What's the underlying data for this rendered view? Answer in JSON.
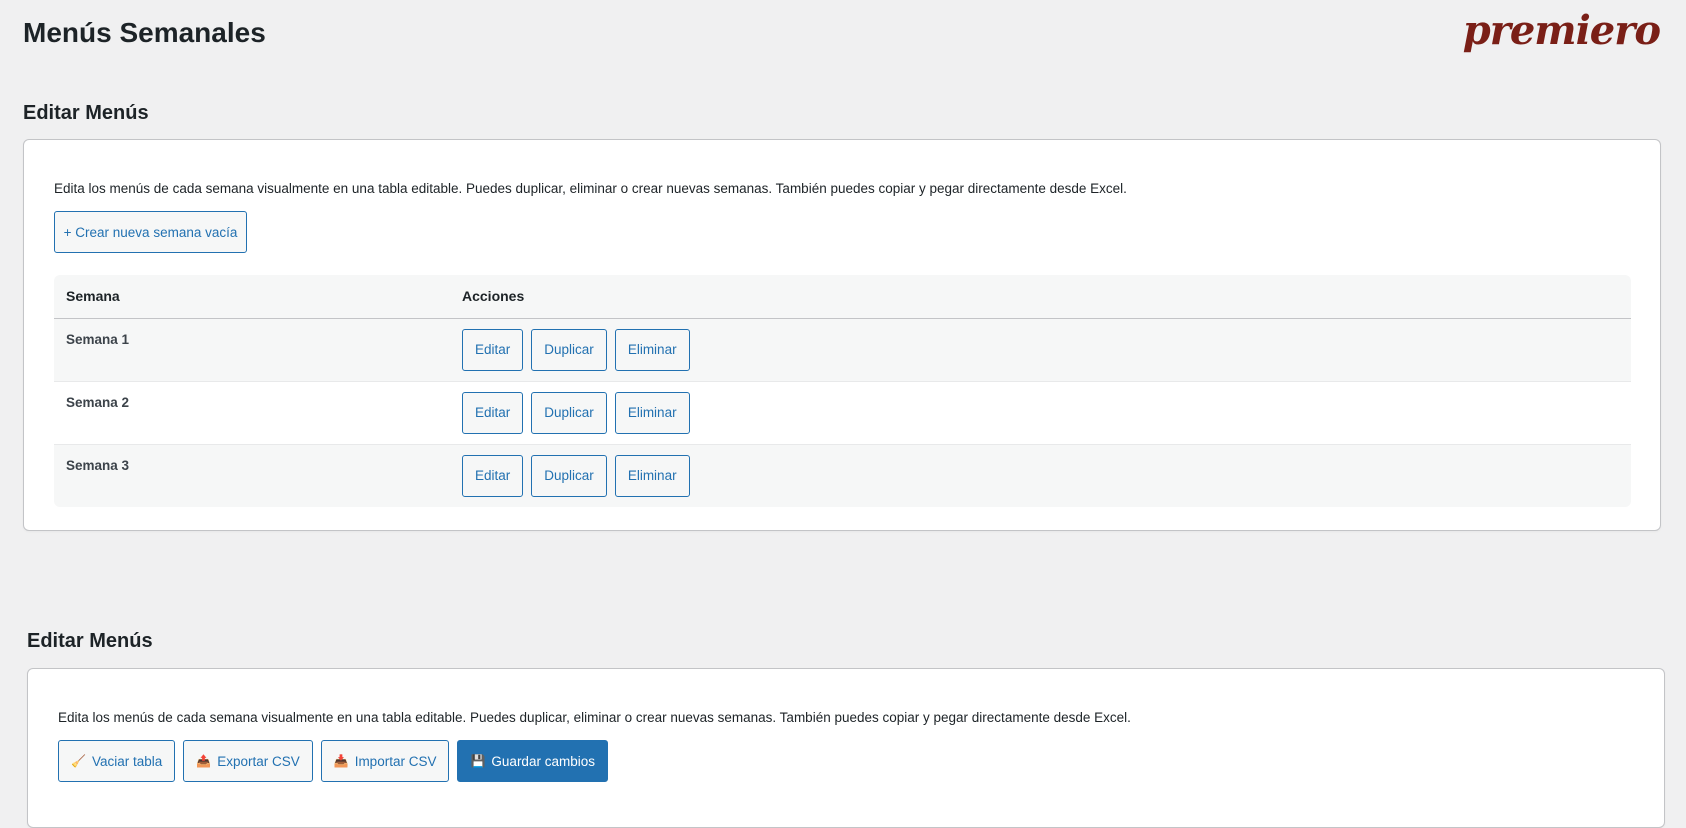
{
  "header": {
    "title": "Menús Semanales",
    "logo_text": "premiero"
  },
  "section1": {
    "title": "Editar Menús",
    "description": "Edita los menús de cada semana visualmente en una tabla editable. Puedes duplicar, eliminar o crear nuevas semanas. También puedes copiar y pegar directamente desde Excel.",
    "create_button": "+ Crear nueva semana vacía",
    "table": {
      "headers": [
        "Semana",
        "Acciones"
      ],
      "rows": [
        {
          "week": "Semana 1",
          "actions": [
            "Editar",
            "Duplicar",
            "Eliminar"
          ]
        },
        {
          "week": "Semana 2",
          "actions": [
            "Editar",
            "Duplicar",
            "Eliminar"
          ]
        },
        {
          "week": "Semana 3",
          "actions": [
            "Editar",
            "Duplicar",
            "Eliminar"
          ]
        }
      ]
    }
  },
  "section2": {
    "title": "Editar Menús",
    "description": "Edita los menús de cada semana visualmente en una tabla editable. Puedes duplicar, eliminar o crear nuevas semanas. También puedes copiar y pegar directamente desde Excel.",
    "toolbar": [
      {
        "label": "Vaciar tabla",
        "icon": "broom-icon",
        "glyph": "🧹",
        "primary": false
      },
      {
        "label": "Exportar CSV",
        "icon": "export-icon",
        "glyph": "📤",
        "primary": false
      },
      {
        "label": "Importar CSV",
        "icon": "import-icon",
        "glyph": "📥",
        "primary": false
      },
      {
        "label": "Guardar cambios",
        "icon": "save-icon",
        "glyph": "💾",
        "primary": true
      }
    ]
  },
  "colors": {
    "accent": "#2271b1",
    "logo": "#7a1f17",
    "background": "#f0f0f1"
  }
}
